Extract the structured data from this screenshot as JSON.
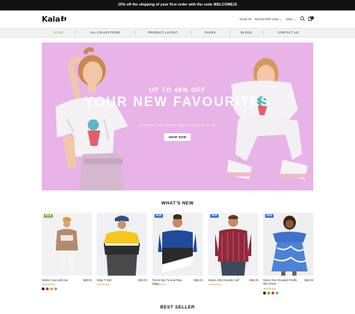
{
  "announcement": "15% off the shipping of your first order with the code WELCOME15",
  "header": {
    "logo": "Kala",
    "sign_in": "SIGN IN",
    "register": "REGISTER",
    "currency": "USD",
    "language": "ENG",
    "cart_count": "0"
  },
  "nav": [
    {
      "label": "HOME"
    },
    {
      "label": "ALL COLLECTIONS"
    },
    {
      "label": "PRODUCT LAYOUT"
    },
    {
      "label": "PAGES"
    },
    {
      "label": "BLOGS"
    },
    {
      "label": "CONTACT US"
    }
  ],
  "hero": {
    "subtitle": "UP TO 40% OFF",
    "title": "YOUR NEW FAVOURITES",
    "description": "Limited time only, selected styles marked down on site",
    "button": "SHOP NOW",
    "background": "#e8b3e7"
  },
  "whats_new": {
    "title": "WHAT'S NEW",
    "products": [
      {
        "name": "Winter Coat with Hat",
        "price": "$69.00",
        "badge": "SALE",
        "badge_color": "#7bb23a",
        "stars": "★★★★★",
        "swatches": [
          "#222222",
          "#c8362f",
          "#e6a23c",
          "#7ba6d6"
        ]
      },
      {
        "name": "Wide T-shirt",
        "price": "$30.00",
        "badge": "",
        "badge_color": "",
        "stars": "★★★★★",
        "swatches": []
      },
      {
        "name": "Pencil Dip Tie and Raw Edge",
        "price": "$55.00",
        "badge": "NEW",
        "badge_color": "#2b67d8",
        "stars": "★★★★★",
        "swatches": []
      },
      {
        "name": "Skinny Shirt Double Cuff",
        "price": "$69.00",
        "badge": "NEW",
        "badge_color": "#2b67d8",
        "stars": "★★★★★",
        "swatches": []
      },
      {
        "name": "Wone One Shoulder Ruffle Mini Dress",
        "price": "$66.00",
        "badge": "NEW",
        "badge_color": "#2b67d8",
        "stars": "★★★★★",
        "swatches": [
          "#222222",
          "#7bb23a",
          "#c8362f",
          "#7ba6d6"
        ]
      }
    ]
  },
  "best_seller": {
    "title": "BEST SELLER"
  },
  "colors": {
    "accent": "#7bb23a",
    "star": "#f4a21e",
    "nav_bg": "#f1f1f1"
  }
}
